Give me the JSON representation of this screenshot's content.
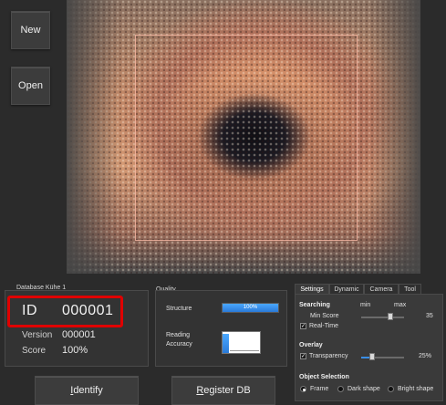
{
  "sidebar": {
    "new_label": "New",
    "open_label": "Open"
  },
  "database": {
    "title": "Database Kühe 1",
    "id_label": "ID",
    "id_value": "000001",
    "version_label": "Version",
    "version_value": "000001",
    "score_label": "Score",
    "score_value": "100%"
  },
  "quality": {
    "title": "Quality",
    "structure_label": "Structure",
    "structure_value": "100%",
    "structure_fraction": 1.0,
    "reading_label_line1": "Reading",
    "reading_label_line2": "Accuracy"
  },
  "tabs": [
    {
      "label": "Settings",
      "active": true
    },
    {
      "label": "Dynamic",
      "active": false
    },
    {
      "label": "Camera",
      "active": false
    },
    {
      "label": "Tool",
      "active": false
    }
  ],
  "settings": {
    "searching": {
      "title": "Searching",
      "min_label": "min",
      "max_label": "max",
      "min_score_label": "Min Score",
      "min_score_value": "35",
      "realtime_label": "Real-Time",
      "realtime_checked": true
    },
    "overlay": {
      "title": "Overlay",
      "transparency_label": "Transparency",
      "transparency_checked": true,
      "transparency_value": "25%"
    },
    "object_selection": {
      "title": "Object Selection",
      "options": [
        "Frame",
        "Dark shape",
        "Bright shape"
      ],
      "selected": "Frame"
    }
  },
  "bottom": {
    "identify_underline": "I",
    "identify_rest": "dentify",
    "register_underline": "R",
    "register_rest": "egister DB"
  },
  "colors": {
    "highlight_red": "#e00000",
    "accent_blue": "#3a8ee6"
  }
}
